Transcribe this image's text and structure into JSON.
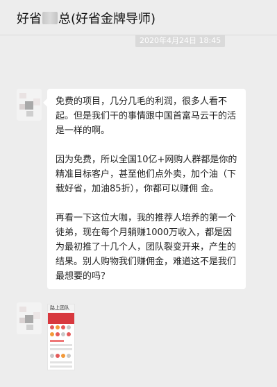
{
  "header": {
    "title_prefix": "好省",
    "title_suffix": "总(好省金牌导师)"
  },
  "timestamp": "2020年4月24日 18:45",
  "messages": [
    {
      "type": "text",
      "paragraphs": [
        "免费的项目，几分几毛的利润，很多人看不起。但是我们干的事情跟中国首富马云干的活是一样的啊。",
        "因为免费，所以全国10亿+网购人群都是你的 精准目标客户，甚至他们点外卖，加个油（下载好省，加油85折），你都可以赚佣 金。",
        "再看一下这位大咖，我的推荐人培养的第一个徒弟，现在每个月躺赚1000万收入，都是因为最初推了十几个人，团队裂变开来，产生的结果。别人购物我们赚佣金，难道这不是我们最想要的吗？"
      ]
    },
    {
      "type": "image",
      "caption": "路上团队"
    }
  ],
  "colors": {
    "background": "#ededed",
    "bubble": "#ffffff",
    "timestamp_bg": "#dadada",
    "banner_red": "#d8383e"
  },
  "icons": {
    "avatar": "avatar-blurred"
  }
}
